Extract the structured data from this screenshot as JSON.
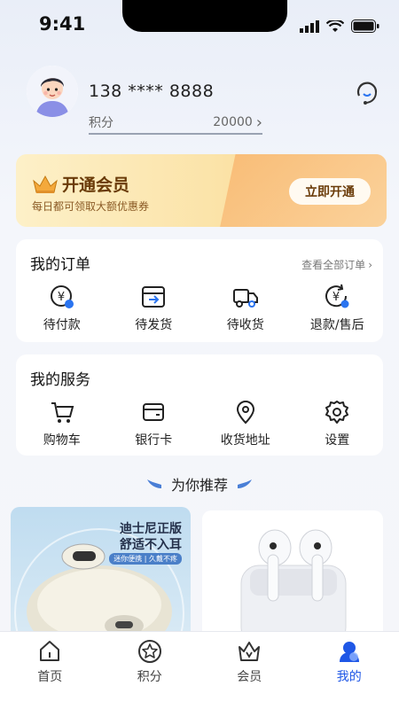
{
  "status_bar": {
    "time": "9:41"
  },
  "profile": {
    "phone": "138 **** 8888",
    "points_label": "积分",
    "points_value": "20000",
    "points_chevron": "›"
  },
  "vip": {
    "title": "开通会员",
    "subtitle": "每日都可领取大额优惠券",
    "button": "立即开通"
  },
  "orders": {
    "title": "我的订单",
    "view_all": "查看全部订单",
    "items": [
      {
        "label": "待付款",
        "icon": "pending-payment-icon"
      },
      {
        "label": "待发货",
        "icon": "pending-shipment-icon"
      },
      {
        "label": "待收货",
        "icon": "delivery-truck-icon"
      },
      {
        "label": "退款/售后",
        "icon": "refund-icon"
      }
    ]
  },
  "services": {
    "title": "我的服务",
    "items": [
      {
        "label": "购物车",
        "icon": "shopping-cart-icon"
      },
      {
        "label": "银行卡",
        "icon": "bank-card-icon"
      },
      {
        "label": "收货地址",
        "icon": "location-pin-icon"
      },
      {
        "label": "设置",
        "icon": "gear-icon"
      }
    ]
  },
  "recommend": {
    "title": "为你推荐"
  },
  "products": [
    {
      "line1": "迪士尼正版",
      "line2": "舒适不入耳",
      "tag": "迷你便携 | 久戴不疼"
    },
    {
      "image": "white-earbuds-case"
    }
  ],
  "tabbar": {
    "items": [
      {
        "label": "首页",
        "icon": "home-icon",
        "active": false
      },
      {
        "label": "积分",
        "icon": "star-icon",
        "active": false
      },
      {
        "label": "会员",
        "icon": "crown-icon",
        "active": false
      },
      {
        "label": "我的",
        "icon": "profile-icon",
        "active": true
      }
    ]
  },
  "colors": {
    "accent": "#1f57e6",
    "vip_text": "#6a3b09",
    "background": "#f5f6fa"
  }
}
